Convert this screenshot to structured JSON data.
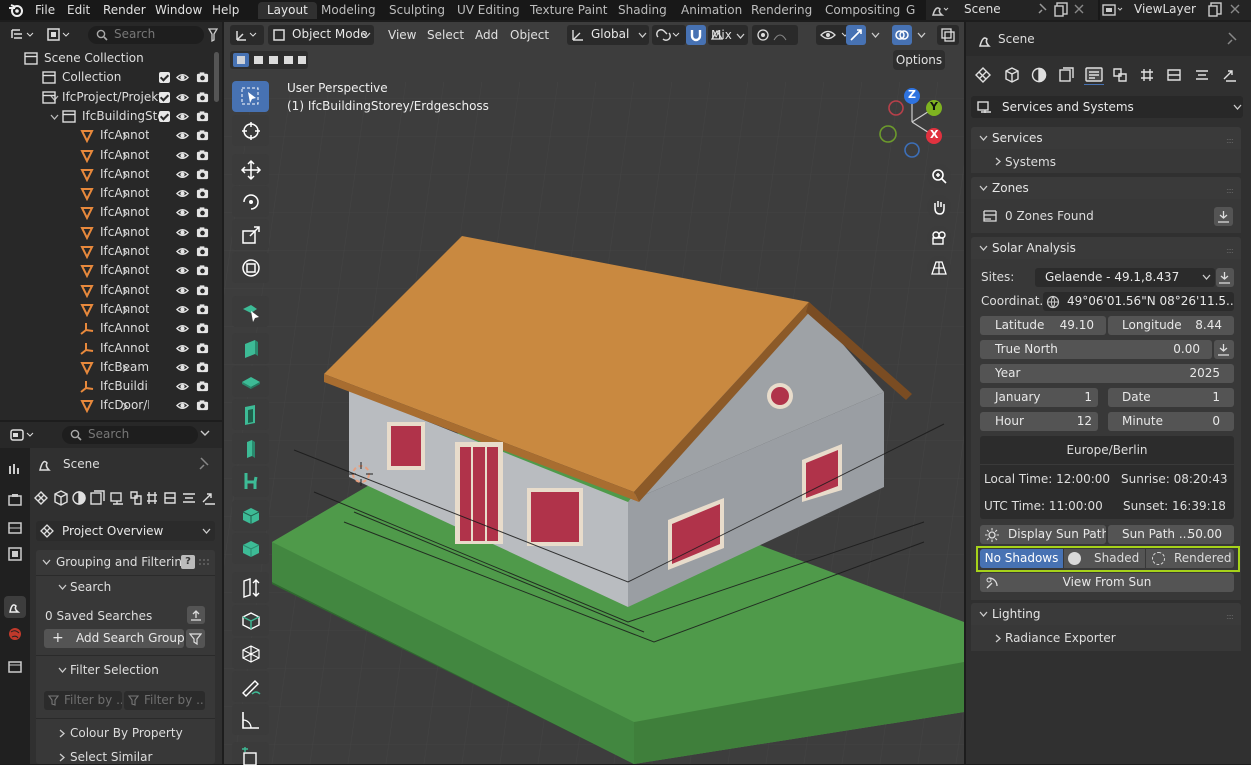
{
  "menu": {
    "file": "File",
    "edit": "Edit",
    "render": "Render",
    "window": "Window",
    "help": "Help"
  },
  "workspaces": [
    "Layout",
    "Modeling",
    "Sculpting",
    "UV Editing",
    "Texture Paint",
    "Shading",
    "Animation",
    "Rendering",
    "Compositing",
    "G"
  ],
  "scene_selector": {
    "value": "Scene"
  },
  "viewlayer_selector": {
    "value": "ViewLayer"
  },
  "outliner": {
    "search_placeholder": "Search",
    "rows": [
      {
        "label": "Scene Collection"
      },
      {
        "label": "Collection"
      },
      {
        "label": "IfcProject/Projekt"
      },
      {
        "label": "IfcBuildingSto"
      },
      {
        "label": "IfcAnnota"
      },
      {
        "label": "IfcAnnota"
      },
      {
        "label": "IfcAnnota"
      },
      {
        "label": "IfcAnnota"
      },
      {
        "label": "IfcAnnota"
      },
      {
        "label": "IfcAnnota"
      },
      {
        "label": "IfcAnnota"
      },
      {
        "label": "IfcAnnota"
      },
      {
        "label": "IfcAnnota"
      },
      {
        "label": "IfcAnnota"
      },
      {
        "label": "IfcAnnota"
      },
      {
        "label": "IfcAnnota"
      },
      {
        "label": "IfcBeam/U"
      },
      {
        "label": "IfcBuilding"
      },
      {
        "label": "IfcDoor/H"
      }
    ]
  },
  "bim_panel": {
    "search_placeholder": "Search",
    "scene_label": "Scene",
    "tab_dropdown": "Project Overview",
    "grouping": {
      "title": "Grouping and Filtering",
      "search": "Search",
      "saved": "0 Saved Searches",
      "add_group": "Add Search Group",
      "filter_selection": "Filter Selection",
      "filter_a": "Filter by ...",
      "filter_b": "Filter by ...",
      "colour": "Colour By Property",
      "select_similar": "Select Similar"
    }
  },
  "viewport": {
    "mode": "Object Mode",
    "menus": [
      "View",
      "Select",
      "Add",
      "Object"
    ],
    "orientation": "Global",
    "shading": "Mix",
    "options": "Options",
    "info_line1": "User Perspective",
    "info_line2": "(1) IfcBuildingStorey/Erdgeschoss",
    "gizmo": {
      "z": "Z",
      "y": "Y",
      "x": "X"
    },
    "colors": {
      "roof": "#c98940",
      "wall": "#b9bcc0",
      "ground": "#4f9a4a",
      "window": "#b0334a"
    }
  },
  "properties": {
    "title": "Scene",
    "dropdown": "Services and Systems",
    "services": "Services",
    "systems": "Systems",
    "zones": "Zones",
    "zones_found": "0 Zones Found",
    "solar": "Solar Analysis",
    "sites_label": "Sites:",
    "sites_value": "Gelaende - 49.1,8.437",
    "coord_label": "Coordinat...",
    "coord_value": "49°06'01.56\"N 08°26'11.5...",
    "latitude_label": "Latitude",
    "latitude": "49.10",
    "longitude_label": "Longitude",
    "longitude": "8.44",
    "true_north_label": "True North",
    "true_north": "0.00",
    "year_label": "Year",
    "year": "2025",
    "month": "January",
    "day_num": "1",
    "date_label": "Date",
    "date": "1",
    "hour_label": "Hour",
    "hour": "12",
    "minute_label": "Minute",
    "minute": "0",
    "timezone": "Europe/Berlin",
    "local_time": "Local Time: 12:00:00",
    "sunrise": "Sunrise: 08:20:43",
    "utc_time": "UTC Time: 11:00:00",
    "sunset": "Sunset: 16:39:18",
    "display_sun": "Display Sun Path",
    "sun_path_label": "Sun Path ...",
    "sun_path": "50.00",
    "shadow_modes": [
      "No Shadows",
      "Shaded",
      "Rendered"
    ],
    "view_from_sun": "View From Sun",
    "lighting": "Lighting",
    "radiance": "Radiance Exporter"
  }
}
